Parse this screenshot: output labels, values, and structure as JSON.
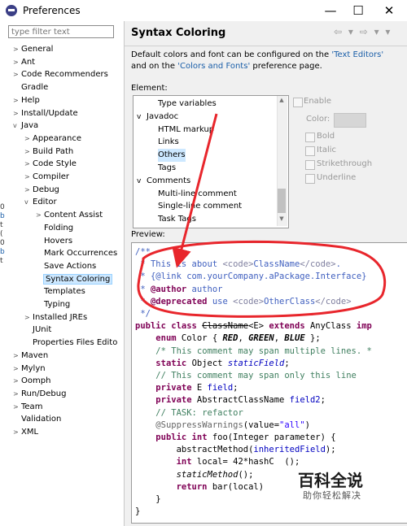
{
  "window": {
    "title": "Preferences",
    "minimize": "—",
    "maximize": "☐",
    "close": "✕"
  },
  "filter": {
    "placeholder": "type filter text"
  },
  "tree": [
    {
      "label": "General",
      "arrow": ">",
      "indent": 0
    },
    {
      "label": "Ant",
      "arrow": ">",
      "indent": 0
    },
    {
      "label": "Code Recommenders",
      "arrow": ">",
      "indent": 0
    },
    {
      "label": "Gradle",
      "arrow": "",
      "indent": 0
    },
    {
      "label": "Help",
      "arrow": ">",
      "indent": 0
    },
    {
      "label": "Install/Update",
      "arrow": ">",
      "indent": 0
    },
    {
      "label": "Java",
      "arrow": "v",
      "indent": 0
    },
    {
      "label": "Appearance",
      "arrow": ">",
      "indent": 1
    },
    {
      "label": "Build Path",
      "arrow": ">",
      "indent": 1
    },
    {
      "label": "Code Style",
      "arrow": ">",
      "indent": 1
    },
    {
      "label": "Compiler",
      "arrow": ">",
      "indent": 1
    },
    {
      "label": "Debug",
      "arrow": ">",
      "indent": 1
    },
    {
      "label": "Editor",
      "arrow": "v",
      "indent": 1
    },
    {
      "label": "Content Assist",
      "arrow": ">",
      "indent": 2
    },
    {
      "label": "Folding",
      "arrow": "",
      "indent": 2
    },
    {
      "label": "Hovers",
      "arrow": "",
      "indent": 2
    },
    {
      "label": "Mark Occurrences",
      "arrow": "",
      "indent": 2
    },
    {
      "label": "Save Actions",
      "arrow": "",
      "indent": 2
    },
    {
      "label": "Syntax Coloring",
      "arrow": "",
      "indent": 2,
      "selected": true
    },
    {
      "label": "Templates",
      "arrow": "",
      "indent": 2
    },
    {
      "label": "Typing",
      "arrow": "",
      "indent": 2
    },
    {
      "label": "Installed JREs",
      "arrow": ">",
      "indent": 1
    },
    {
      "label": "JUnit",
      "arrow": "",
      "indent": 1
    },
    {
      "label": "Properties Files Edito",
      "arrow": "",
      "indent": 1
    },
    {
      "label": "Maven",
      "arrow": ">",
      "indent": 0
    },
    {
      "label": "Mylyn",
      "arrow": ">",
      "indent": 0
    },
    {
      "label": "Oomph",
      "arrow": ">",
      "indent": 0
    },
    {
      "label": "Run/Debug",
      "arrow": ">",
      "indent": 0
    },
    {
      "label": "Team",
      "arrow": ">",
      "indent": 0
    },
    {
      "label": "Validation",
      "arrow": "",
      "indent": 0
    },
    {
      "label": "XML",
      "arrow": ">",
      "indent": 0
    }
  ],
  "left_edge_glyphs": [
    "0",
    "b",
    "t",
    "(",
    "0",
    "b",
    "t"
  ],
  "page": {
    "title": "Syntax Coloring",
    "nav": "⇦ ▾ ⇨ ▾ ▾",
    "desc_1": "Default colors and font can be configured on the ",
    "link_1": "'Text Editors'",
    "desc_2": " and on the ",
    "link_2": "'Colors and Fonts'",
    "desc_3": " preference page.",
    "element_label": "Element:",
    "preview_label": "Preview:"
  },
  "elements": [
    {
      "label": "Type variables",
      "arrow": "",
      "indent": 2
    },
    {
      "label": "Javadoc",
      "arrow": "v",
      "indent": 1
    },
    {
      "label": "HTML markup",
      "arrow": "",
      "indent": 2
    },
    {
      "label": "Links",
      "arrow": "",
      "indent": 2
    },
    {
      "label": "Others",
      "arrow": "",
      "indent": 2,
      "selected": true
    },
    {
      "label": "Tags",
      "arrow": "",
      "indent": 2
    },
    {
      "label": "Comments",
      "arrow": "v",
      "indent": 1
    },
    {
      "label": "Multi-line comment",
      "arrow": "",
      "indent": 2
    },
    {
      "label": "Single-line comment",
      "arrow": "",
      "indent": 2
    },
    {
      "label": "Task Tags",
      "arrow": "",
      "indent": 2
    }
  ],
  "options": {
    "enable": "Enable",
    "color": "Color:",
    "bold": "Bold",
    "italic": "Italic",
    "strikethrough": "Strikethrough",
    "underline": "Underline"
  },
  "code": [
    [
      [
        "jd",
        "/**"
      ]
    ],
    [
      [
        "jd",
        " * This is about "
      ],
      [
        "tag",
        "<code>"
      ],
      [
        "jd",
        "ClassName"
      ],
      [
        "tag",
        "</code>"
      ],
      [
        "jd",
        "."
      ]
    ],
    [
      [
        "jd",
        " * "
      ],
      [
        "jd",
        "{@link com.yourCompany.aPackage.Interface}"
      ]
    ],
    [
      [
        "jd",
        " * "
      ],
      [
        "kw",
        "@author"
      ],
      [
        "jd",
        " author"
      ]
    ],
    [
      [
        "jd",
        " * "
      ],
      [
        "kw",
        "@deprecated"
      ],
      [
        "jd",
        " use "
      ],
      [
        "tag",
        "<code>"
      ],
      [
        "jd",
        "OtherClass"
      ],
      [
        "tag",
        "</code>"
      ]
    ],
    [
      [
        "jd",
        " */"
      ]
    ],
    [
      [
        "kw",
        "public class "
      ],
      [
        "strike",
        "ClassName"
      ],
      [
        "",
        "<E> "
      ],
      [
        "kw",
        "extends "
      ],
      [
        "",
        "AnyClass "
      ],
      [
        "kw",
        "imp"
      ]
    ],
    [
      [
        "",
        "    "
      ],
      [
        "kw",
        "enum "
      ],
      [
        "",
        "Color { "
      ],
      [
        "enumc",
        "RED"
      ],
      [
        "",
        ", "
      ],
      [
        "enumc",
        "GREEN"
      ],
      [
        "",
        ", "
      ],
      [
        "enumc",
        "BLUE"
      ],
      [
        "",
        " };"
      ]
    ],
    [
      [
        "",
        "    "
      ],
      [
        "cm",
        "/* This comment may span multiple lines. *"
      ]
    ],
    [
      [
        "",
        "    "
      ],
      [
        "kw",
        "static "
      ],
      [
        "",
        "Object "
      ],
      [
        "sfld",
        "staticField"
      ],
      [
        "",
        ";"
      ]
    ],
    [
      [
        "",
        "    "
      ],
      [
        "cm",
        "// This comment may span only this line"
      ]
    ],
    [
      [
        "",
        "    "
      ],
      [
        "kw",
        "private "
      ],
      [
        "",
        "E "
      ],
      [
        "fld",
        "field"
      ],
      [
        "",
        ";"
      ]
    ],
    [
      [
        "",
        "    "
      ],
      [
        "kw",
        "private "
      ],
      [
        "",
        "AbstractClassName "
      ],
      [
        "fld",
        "field2"
      ],
      [
        "",
        ";"
      ]
    ],
    [
      [
        "",
        "    "
      ],
      [
        "cm",
        "// TASK: refactor"
      ]
    ],
    [
      [
        "",
        "    "
      ],
      [
        "ann",
        "@SuppressWarnings"
      ],
      [
        "",
        "(value="
      ],
      [
        "str",
        "\"all\""
      ],
      [
        "",
        ")"
      ]
    ],
    [
      [
        "",
        "    "
      ],
      [
        "kw",
        "public int "
      ],
      [
        "",
        "foo(Integer parameter) {"
      ]
    ],
    [
      [
        "",
        "        abstractMethod("
      ],
      [
        "fld",
        "inheritedField"
      ],
      [
        "",
        ");"
      ]
    ],
    [
      [
        "",
        "        "
      ],
      [
        "kw",
        "int "
      ],
      [
        "",
        "local= 42*hashC  ();"
      ]
    ],
    [
      [
        "",
        "        "
      ],
      [
        "smeth",
        "staticMethod"
      ],
      [
        "",
        "();"
      ]
    ],
    [
      [
        "",
        "        "
      ],
      [
        "kw",
        "return "
      ],
      [
        "",
        "bar(local)"
      ]
    ],
    [
      [
        "",
        "    }"
      ]
    ],
    [
      [
        "",
        "}"
      ]
    ]
  ],
  "watermark": {
    "main": "百科全说",
    "sub": "助你轻松解决"
  },
  "colors": {
    "annotation_red": "#e8262c",
    "selection": "#cde8ff",
    "link": "#1a5ea8"
  }
}
